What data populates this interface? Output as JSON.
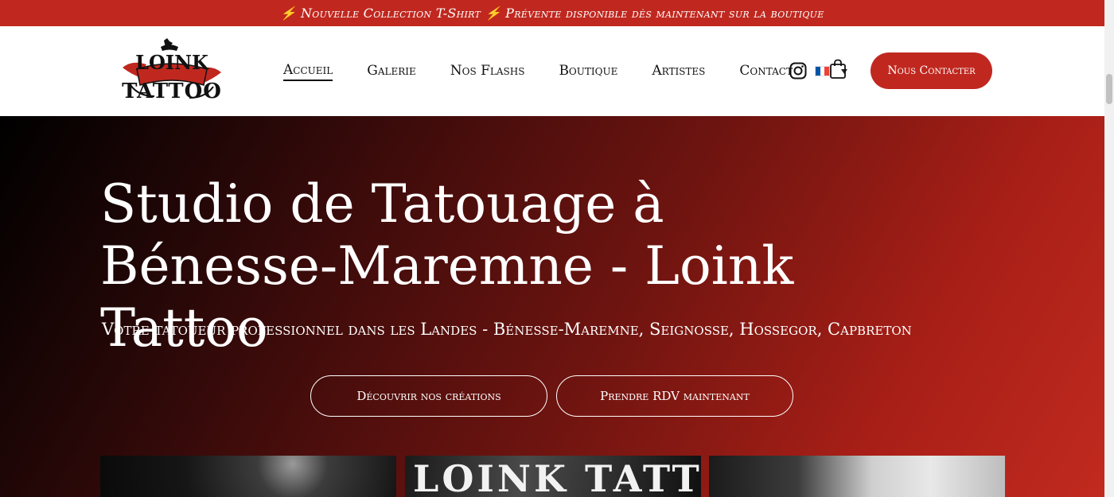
{
  "announcement": {
    "text": "⚡ Nouvelle Collection T-Shirt ⚡ Prévente disponible dès maintenant sur la boutique"
  },
  "header": {
    "logo": {
      "line1": "LOINK",
      "line2": "TATTOO",
      "icon": "tattoo-logo-icon"
    },
    "nav": [
      {
        "label": "Accueil",
        "active": true
      },
      {
        "label": "Galerie"
      },
      {
        "label": "Nos Flashs"
      },
      {
        "label": "Boutique"
      },
      {
        "label": "Artistes"
      },
      {
        "label": "Contact"
      }
    ],
    "language": {
      "icon": "france-flag-icon",
      "colors": [
        "#0055a4",
        "#ffffff",
        "#ef4135"
      ]
    },
    "icons": [
      "instagram-icon",
      "shopping-bag-icon"
    ],
    "cta_label": "Nous Contacter"
  },
  "hero": {
    "title": "Studio de Tatouage à Bénesse-Maremne - Loink Tattoo",
    "subtitle": "Votre tatoueur professionnel dans les Landes -  Bénesse-Maremne, Seignosse, Hossegor, Capbreton",
    "buttons": [
      {
        "label": "Découvrir nos créations"
      },
      {
        "label": "Prendre RDV maintenant"
      }
    ],
    "gallery": [
      {
        "alt": "tattoo-photo-1"
      },
      {
        "alt": "tattoo-photo-2",
        "overlay_text": "LOINK TATTOO"
      },
      {
        "alt": "tattoo-photo-3"
      }
    ]
  },
  "colors": {
    "accent": "#c0281f",
    "text_dark": "#111111",
    "hero_dark": "#000000",
    "hero_red": "#c12a1f"
  }
}
